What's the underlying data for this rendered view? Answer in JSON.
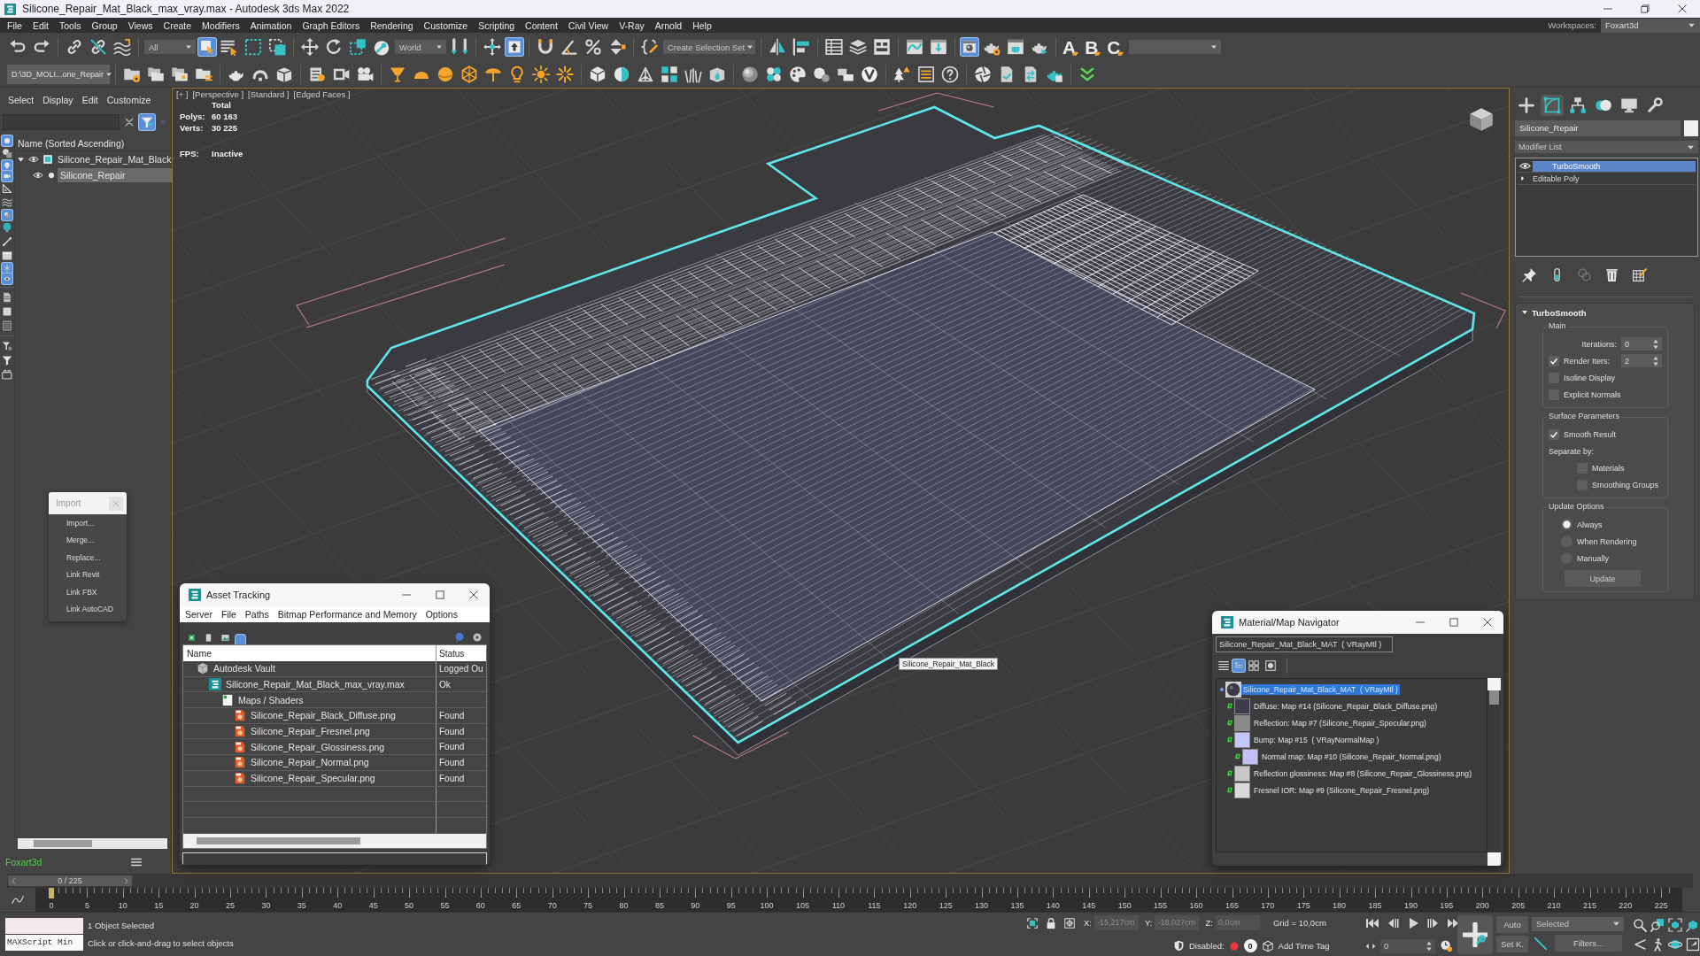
{
  "window": {
    "title": "Silicone_Repair_Mat_Black_max_vray.max - Autodesk 3ds Max 2022"
  },
  "menu_bar": {
    "items": [
      "File",
      "Edit",
      "Tools",
      "Group",
      "Views",
      "Create",
      "Modifiers",
      "Animation",
      "Graph Editors",
      "Rendering",
      "Customize",
      "Scripting",
      "Content",
      "Civil View",
      "V-Ray",
      "Arnold",
      "Help"
    ],
    "workspaces_label": "Workspaces:",
    "workspace": "Foxart3d"
  },
  "main_toolbar": {
    "selection_filter": "All",
    "reference_coordinate_system": "World",
    "named_selection_set": "Create Selection Set",
    "buttons": [
      {
        "selected": false
      },
      {
        "selected": false
      },
      {
        "selected": false
      },
      {
        "selected": false
      },
      {
        "selected": false
      },
      {
        "selected": true
      },
      {
        "selected": false
      },
      {
        "selected": false
      },
      {
        "selected": false
      },
      {
        "selected": false
      },
      {
        "selected": false
      },
      {
        "selected": false
      },
      {
        "selected": false
      },
      {
        "selected": false
      },
      {
        "selected": false
      },
      {
        "selected": true
      },
      {
        "selected": false
      },
      {
        "selected": false
      },
      {
        "selected": false
      },
      {
        "selected": false
      },
      {
        "selected": false
      },
      {
        "selected": false
      },
      {
        "selected": false
      },
      {
        "selected": false
      },
      {
        "selected": false
      },
      {
        "selected": false
      },
      {
        "selected": false
      },
      {
        "selected": false
      },
      {
        "selected": true
      },
      {
        "selected": false
      },
      {
        "selected": false
      },
      {
        "selected": false
      }
    ],
    "letter_buttons": [
      "A",
      "B",
      "C"
    ]
  },
  "secondary_toolbar": {
    "project_folder": "D:\\3D_MOLI...one_Repair"
  },
  "scene_explorer": {
    "menu": [
      "Select",
      "Display",
      "Edit",
      "Customize"
    ],
    "filter_button": {
      "selected": true
    },
    "filter_buttons": [
      {
        "selected": true
      },
      {
        "selected": false
      },
      {
        "selected": true
      },
      {
        "selected": true
      },
      {
        "selected": false
      },
      {
        "selected": false
      },
      {
        "selected": true
      },
      {
        "selected": false
      },
      {
        "selected": false
      },
      {
        "selected": false
      },
      {
        "selected": true
      },
      {
        "selected": true
      },
      {
        "selected": false
      },
      {
        "selected": false
      },
      {
        "selected": false
      },
      {
        "selected": false
      },
      {
        "selected": false
      },
      {
        "selected": false
      }
    ],
    "header": "Name (Sorted Ascending)",
    "tree": [
      {
        "label": "Silicone_Repair_Mat_Black",
        "expanded": true,
        "selected": false,
        "children": [
          {
            "label": "Silicone_Repair",
            "selected": true
          }
        ]
      }
    ],
    "footer": "Foxart3d"
  },
  "import_menu": {
    "title": "Import",
    "items": [
      "Import...",
      "Merge...",
      "Replace...",
      "Link Revit",
      "Link FBX",
      "Link AutoCAD"
    ]
  },
  "viewport": {
    "menus": [
      "[+ ]",
      "[Perspective ]",
      "[Standard ]",
      "[Edged Faces ]"
    ],
    "stats": {
      "heading": "Total",
      "rows": [
        {
          "label": "Polys:",
          "value": "60 163"
        },
        {
          "label": "Verts:",
          "value": "30 225"
        }
      ],
      "fps_label": "FPS:",
      "fps_value": "Inactive"
    },
    "tooltip": "Silicone_Repair_Mat_Black"
  },
  "asset_tracking": {
    "title": "Asset Tracking",
    "menu": [
      "Server",
      "File",
      "Paths",
      "Bitmap Performance and Memory",
      "Options"
    ],
    "view_buttons": [
      {
        "selected": false
      },
      {
        "selected": false
      },
      {
        "selected": false
      },
      {
        "selected": true
      }
    ],
    "columns": [
      "Name",
      "Status"
    ],
    "rows": [
      {
        "name": "Autodesk Vault",
        "status": "Logged Ou",
        "kind": "vault",
        "children": [
          {
            "name": "Silicone_Repair_Mat_Black_max_vray.max",
            "status": "Ok",
            "kind": "scene",
            "children": [
              {
                "name": "Maps / Shaders",
                "kind": "folder",
                "children": [
                  {
                    "name": "Silicone_Repair_Black_Diffuse.png",
                    "status": "Found",
                    "kind": "bitmap"
                  },
                  {
                    "name": "Silicone_Repair_Fresnel.png",
                    "status": "Found",
                    "kind": "bitmap"
                  },
                  {
                    "name": "Silicone_Repair_Glossiness.png",
                    "status": "Found",
                    "kind": "bitmap"
                  },
                  {
                    "name": "Silicone_Repair_Normal.png",
                    "status": "Found",
                    "kind": "bitmap"
                  },
                  {
                    "name": "Silicone_Repair_Specular.png",
                    "status": "Found",
                    "kind": "bitmap"
                  }
                ]
              }
            ]
          }
        ]
      }
    ]
  },
  "material_navigator": {
    "title": "Material/Map Navigator",
    "material_field": "Silicone_Repair_Mat_Black_MAT  ( VRayMtl )",
    "view_buttons": [
      {
        "selected": false
      },
      {
        "selected": true
      },
      {
        "selected": false
      },
      {
        "selected": false
      }
    ],
    "tree": [
      {
        "label": "Silicone_Repair_Mat_Black_MAT  ( VRayMtl )",
        "kind": "material",
        "selected": true,
        "children": [
          {
            "label": "Diffuse: Map #14 (Silicone_Repair_Black_Diffuse.png)",
            "kind": "map",
            "color": "#3c3c4a",
            "selected": false
          },
          {
            "label": "Reflection: Map #7 (Silicone_Repair_Specular.png)",
            "kind": "map",
            "color": "#8a8a8a",
            "selected": false
          },
          {
            "label": "Bump: Map #15  ( VRayNormalMap )",
            "kind": "map",
            "color": "#c6c6ff",
            "selected": false,
            "children": [
              {
                "label": "Normal map: Map #10 (Silicone_Repair_Normal.png)",
                "kind": "map",
                "color": "#c2c2f8",
                "selected": false
              }
            ]
          },
          {
            "label": "Reflection glossiness: Map #8 (Silicone_Repair_Glossiness.png)",
            "kind": "map",
            "color": "#c8c8c8",
            "selected": false
          },
          {
            "label": "Fresnel IOR: Map #9 (Silicone_Repair_Fresnel.png)",
            "kind": "map",
            "color": "#dadada",
            "selected": false
          }
        ]
      }
    ]
  },
  "command_panel": {
    "tabs": [
      {
        "selected": false
      },
      {
        "selected": true
      },
      {
        "selected": false
      },
      {
        "selected": false
      },
      {
        "selected": false
      },
      {
        "selected": false
      }
    ],
    "object_name": "Silicone_Repair",
    "modifier_list": "Modifier List",
    "stack": [
      {
        "label": "TurboSmooth",
        "kind": "modifier",
        "selected": true
      },
      {
        "label": "Editable Poly",
        "kind": "base_object",
        "selected": false
      }
    ],
    "rollout": {
      "title": "TurboSmooth",
      "groups": [
        {
          "title": "Main",
          "controls": [
            {
              "kind": "spinner",
              "label": "Iterations:",
              "value": "0"
            },
            {
              "kind": "check_spinner",
              "label": "Render Iters:",
              "checked": true,
              "value": "2"
            },
            {
              "kind": "checkbox",
              "label": "Isoline Display",
              "checked": false
            },
            {
              "kind": "checkbox",
              "label": "Explicit Normals",
              "checked": false
            }
          ]
        },
        {
          "title": "Surface Parameters",
          "controls": [
            {
              "kind": "checkbox",
              "label": "Smooth Result",
              "checked": true
            },
            {
              "kind": "text",
              "label": "Separate by:"
            },
            {
              "kind": "sub_checkbox",
              "label": "Materials",
              "checked": false
            },
            {
              "kind": "sub_checkbox",
              "label": "Smoothing Groups",
              "checked": false
            }
          ]
        },
        {
          "title": "Update Options",
          "controls": [
            {
              "kind": "radio",
              "label": "Always",
              "selected": true
            },
            {
              "kind": "radio",
              "label": "When Rendering",
              "selected": false
            },
            {
              "kind": "radio",
              "label": "Manually",
              "selected": false
            },
            {
              "kind": "button",
              "label": "Update"
            }
          ]
        }
      ]
    }
  },
  "timeline": {
    "frame_slider": "0 / 225",
    "ticks": [
      "0",
      "5",
      "10",
      "15",
      "20",
      "25",
      "30",
      "35",
      "40",
      "45",
      "50",
      "55",
      "60",
      "65",
      "70",
      "75",
      "80",
      "85",
      "90",
      "95",
      "100",
      "105",
      "110",
      "115",
      "120",
      "125",
      "130",
      "135",
      "140",
      "145",
      "150",
      "155",
      "160",
      "165",
      "170",
      "175",
      "180",
      "185",
      "190",
      "195",
      "200",
      "205",
      "210",
      "215",
      "220",
      "225"
    ]
  },
  "status_bar": {
    "listener": "MAXScript Min",
    "selection": "1 Object Selected",
    "prompt": "Click or click-and-drag to select objects",
    "coordinates": [
      {
        "axis": "X:",
        "value": "-15,217cm",
        "disabled": true
      },
      {
        "axis": "Y:",
        "value": "-18,027cm",
        "disabled": true
      },
      {
        "axis": "Z:",
        "value": "0,0cm",
        "disabled": true
      }
    ],
    "grid": "Grid = 10,0cm",
    "time_tag_state": "Disabled:",
    "key_count": "0",
    "time_tag": "Add Time Tag",
    "current_frame": "0",
    "auto_key": "Auto",
    "set_key": "Set K.",
    "key_filter": "Selected",
    "filters": "Filters..."
  }
}
